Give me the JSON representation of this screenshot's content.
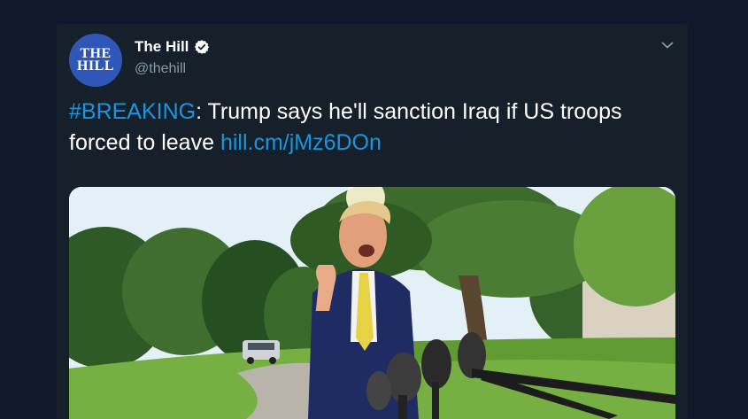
{
  "colors": {
    "page_background": "#10182e",
    "card_background": "#15202b",
    "accent_link": "#1b95e0",
    "text_primary": "#ffffff",
    "text_secondary": "#8899a6",
    "avatar_background": "#2f57b7"
  },
  "author": {
    "avatar_line1": "THE",
    "avatar_line2": "HILL",
    "display_name": "The Hill",
    "handle": "@thehill",
    "verified_icon": "verified-badge-icon"
  },
  "tweet": {
    "hashtag": "#BREAKING",
    "text_after_hashtag": ": Trump says he'll sanction Iraq if US troops forced to leave ",
    "link_text": "hill.cm/jMz6DOn"
  },
  "menu": {
    "icon": "chevron-down-icon"
  },
  "media": {
    "type": "photo"
  }
}
